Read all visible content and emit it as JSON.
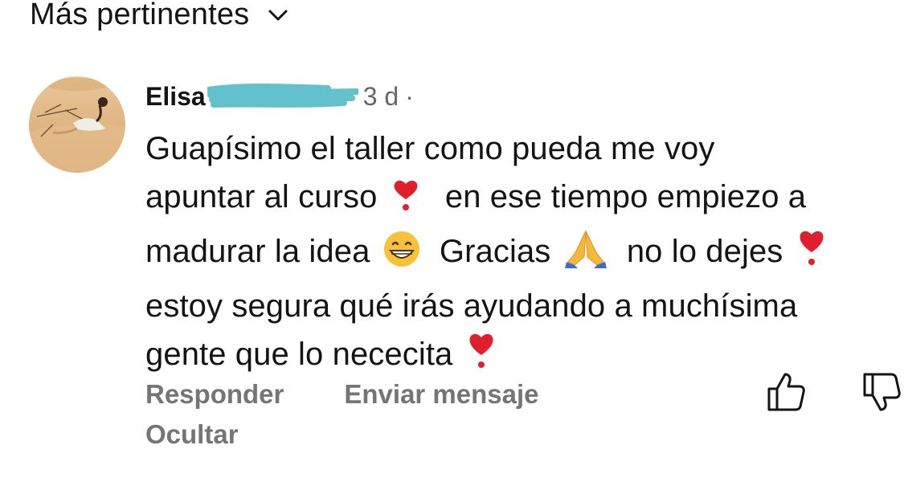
{
  "sort": {
    "label": "Más pertinentes",
    "icon": "chevron-down-icon"
  },
  "comment": {
    "author": "Elisa",
    "time": "3 d",
    "separator": "·",
    "lines": [
      "Guapísimo el taller como pueda me voy",
      "apuntar al curso",
      "en ese tiempo empiezo a",
      "madurar la idea",
      "Gracias",
      "no lo dejes",
      "estoy segura qué irás ayudando a muchísima",
      "gente que lo nececita"
    ],
    "emojis": {
      "heart": "heavy-heart-exclamation",
      "grin": "grinning-face-with-smiling-eyes",
      "pray": "folded-hands"
    }
  },
  "actions": {
    "reply": "Responder",
    "message": "Enviar mensaje",
    "hide": "Ocultar"
  },
  "icons": {
    "like": "thumbs-up-icon",
    "dislike": "thumbs-down-icon"
  },
  "colors": {
    "text": "#141414",
    "muted": "#757575",
    "redaction": "#5bbec9"
  }
}
